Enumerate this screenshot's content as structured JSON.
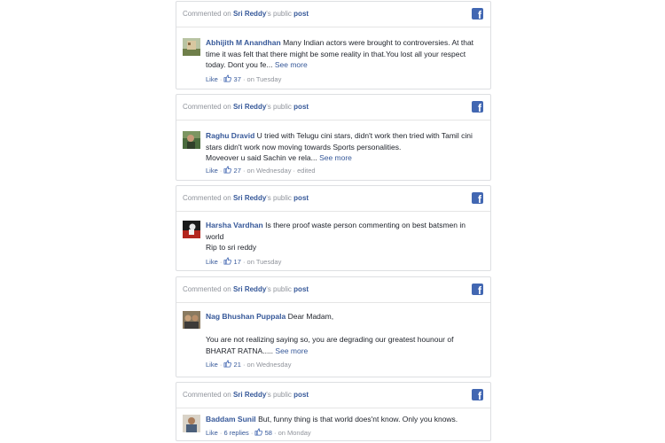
{
  "header": {
    "prefix": "Commented on",
    "page_name": "Sri Reddy",
    "suffix": "'s public",
    "post_label": "post"
  },
  "comments": [
    {
      "author": "Abhijith M Anandhan",
      "text": "Many Indian actors were brought to controversies. At that time it was felt that there might be some reality in that.You lost all your respect today. Dont you fe...",
      "see_more": "See more",
      "like": "Like",
      "likes": "37",
      "time": "on Tuesday"
    },
    {
      "author": "Raghu Dravid",
      "text": "U tried with Telugu cini stars, didn't work then tried with Tamil cini stars didn't work now moving towards Sports personalities.",
      "text2": "Moveover u said Sachin ve rela...",
      "see_more": "See more",
      "like": "Like",
      "likes": "27",
      "time": "on Wednesday",
      "edited": "edited"
    },
    {
      "author": "Harsha Vardhan",
      "text": "Is there proof waste person commenting on best batsmen in world",
      "text2": "Rip to sri reddy",
      "like": "Like",
      "likes": "17",
      "time": "on Tuesday"
    },
    {
      "author": "Nag Bhushan Puppala",
      "text": "Dear Madam,",
      "text2": "You are not realizing saying so, you are degrading our greatest hounour of BHARAT RATNA.....",
      "see_more": "See more",
      "like": "Like",
      "likes": "21",
      "time": "on Wednesday"
    },
    {
      "author": "Baddam Sunil",
      "text": "But, funny thing is that world does'nt know. Only you knows.",
      "like": "Like",
      "replies": "6 replies",
      "likes": "58",
      "time": "on Monday"
    }
  ],
  "icons": {
    "facebook": "facebook-icon",
    "like": "thumbs-up-icon"
  },
  "colors": {
    "link": "#365899",
    "muted": "#90949c",
    "facebook_blue": "#4267b2",
    "border": "#dddfe2"
  }
}
